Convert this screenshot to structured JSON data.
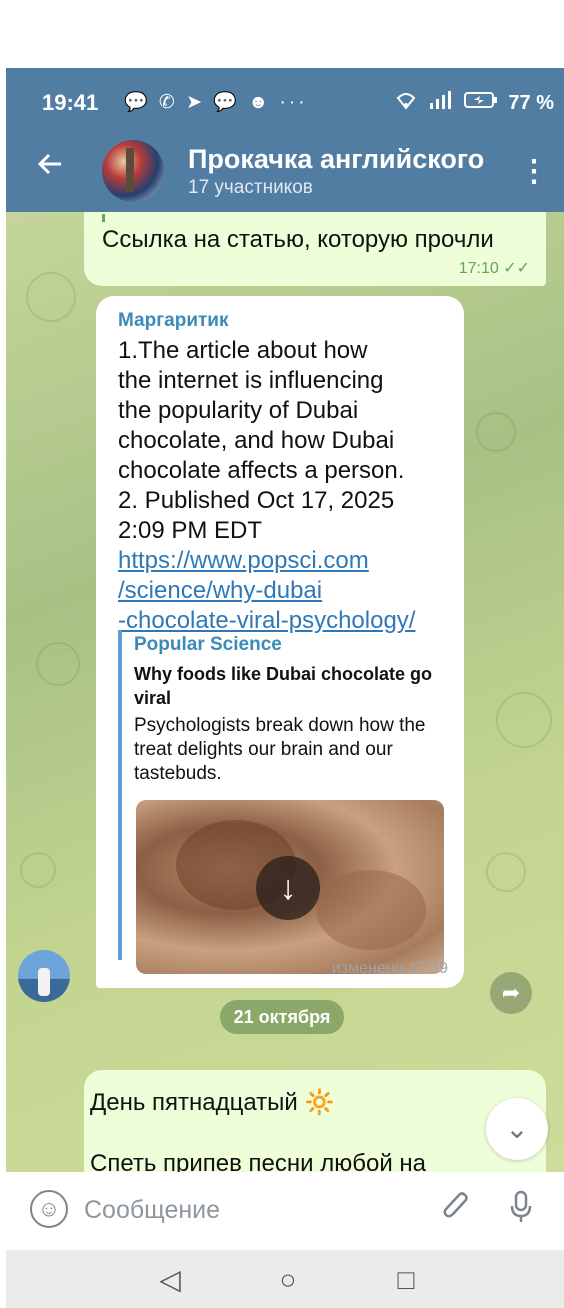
{
  "status_bar": {
    "time": "19:41",
    "notification_icons": "💬 ✆ ➤ 💬 ☻ ···",
    "battery": "77 %"
  },
  "header": {
    "back_icon": "arrow-left-icon",
    "title": "Прокачка английского",
    "subtitle": "17 участников",
    "menu_icon": "more-vert-icon"
  },
  "messages": {
    "outgoing_1": {
      "text": "Ссылка на статью, которую прочли",
      "time": "17:10 ✓✓"
    },
    "incoming_1": {
      "sender": "Маргаритик",
      "lines": [
        "1.The article about how",
        "the internet is influencing",
        "the popularity of Dubai",
        "chocolate,  and how Dubai",
        "chocolate affects a person.",
        "2. Published Oct 17, 2025",
        "2:09 PM EDT"
      ],
      "link_lines": [
        "https://www.popsci.com",
        "/science/why-dubai",
        "-chocolate-viral-psychology/"
      ],
      "preview": {
        "site": "Popular Science",
        "title": "Why foods like Dubai chocolate go viral",
        "description": "Psychologists break down how the treat delights our brain and our tastebuds."
      },
      "time": "изменено 17:39"
    },
    "date_separator": "21 октября",
    "outgoing_2": {
      "line1": "День пятнадцатый 🔆",
      "line2": "Спеть припев песни любой на"
    }
  },
  "input": {
    "placeholder": "Сообщение"
  },
  "nav": {
    "back": "◁",
    "home": "○",
    "recent": "□"
  },
  "colors": {
    "header": "#527da3",
    "outgoing_bubble": "#eefed9",
    "link": "#2f78b8",
    "sender": "#3c8ab8"
  }
}
